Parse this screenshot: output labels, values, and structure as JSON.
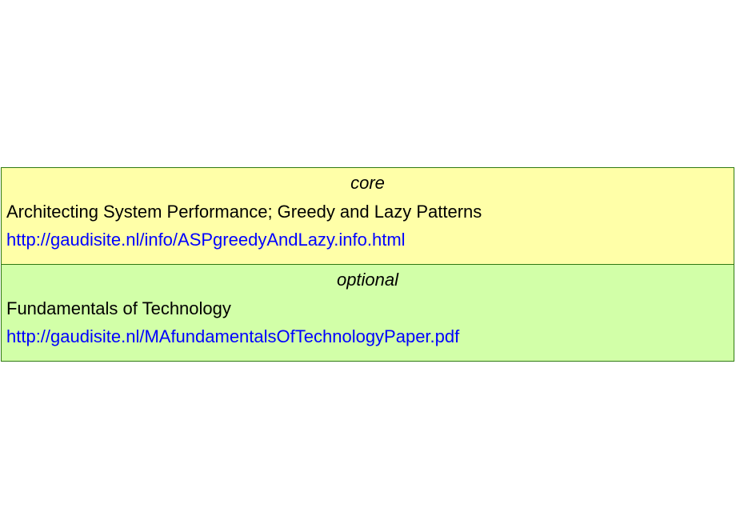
{
  "sections": [
    {
      "heading": "core",
      "title": "Architecting System Performance; Greedy and Lazy Patterns",
      "link": "http://gaudisite.nl/info/ASPgreedyAndLazy.info.html"
    },
    {
      "heading": "optional",
      "title": "Fundamentals of Technology",
      "link": "http://gaudisite.nl/MAfundamentalsOfTechnologyPaper.pdf"
    }
  ],
  "colors": {
    "core_background": "#ffffa8",
    "optional_background": "#d2ffa8",
    "border": "#2f7a12",
    "link": "#0000ff"
  }
}
